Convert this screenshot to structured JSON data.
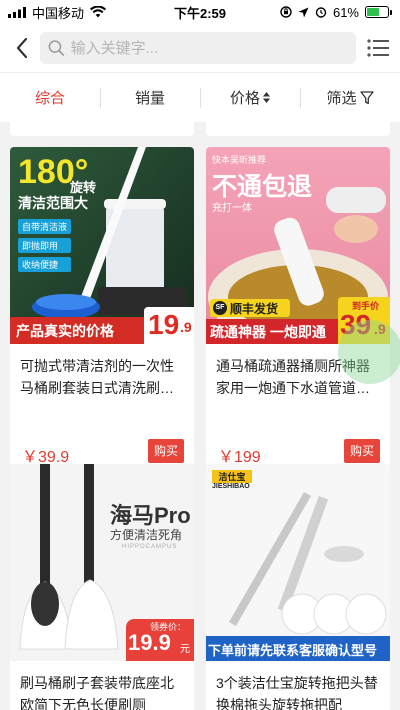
{
  "status": {
    "carrier": "中国移动",
    "time": "下午2:59",
    "battery": "61%",
    "battery_level": 0.61,
    "icons": [
      "signal-icon",
      "wifi-icon",
      "orientation-lock-icon",
      "location-icon",
      "alarm-icon",
      "battery-icon"
    ]
  },
  "header": {
    "search_placeholder": "输入关键字...",
    "icons": [
      "back-chevron-icon",
      "search-icon",
      "list-menu-icon"
    ]
  },
  "sort": {
    "items": [
      "综合",
      "销量",
      "价格",
      "筛选"
    ],
    "active": "综合",
    "accent": "#e33b2e"
  },
  "products": [
    {
      "title": "可抛式带清洁剂的一次性马桶刷套装日式清洗刷…",
      "price": "￥39.9",
      "buy": "购买",
      "image_text": {
        "t180": "180°",
        "rotate": "旋转",
        "range": "清洁范围大",
        "tags": [
          "自带清洁液",
          "即抛即用",
          "收纳便捷"
        ],
        "banner": "产品真实的价格",
        "price_big": "19",
        "price_small": ".9"
      }
    },
    {
      "title": "通马桶疏通器捅厕所神器家用一炮通下水道管道…",
      "price": "￥199",
      "buy": "购买",
      "image_text": {
        "recommend": "快本吴昕推荐",
        "headline": "不通包退",
        "sub": "充打一体",
        "sf": "SF",
        "shipping": "顺丰发货",
        "banner": "疏通神器 一炮即通",
        "handprice": "到手价",
        "price_big": "39",
        "price_small": ".9"
      }
    },
    {
      "title": "刷马桶刷子套装带底座北欧简下无色长便刷厕",
      "price": "",
      "buy": "",
      "image_text": {
        "brand": "海马Pro",
        "slogan": "方便清洁死角",
        "english": "HIPPOCAMPUS",
        "coupon": "领券价：",
        "price_big": "19.9",
        "unit": "元"
      }
    },
    {
      "title": "3个装洁仕宝旋转拖把头替换棉拖头旋转拖把配",
      "price": "",
      "buy": "",
      "image_text": {
        "logo_cn": "洁仕宝",
        "logo_en": "JIESHIBAO",
        "banner": "下单前请先联系客服确认型号"
      }
    }
  ]
}
